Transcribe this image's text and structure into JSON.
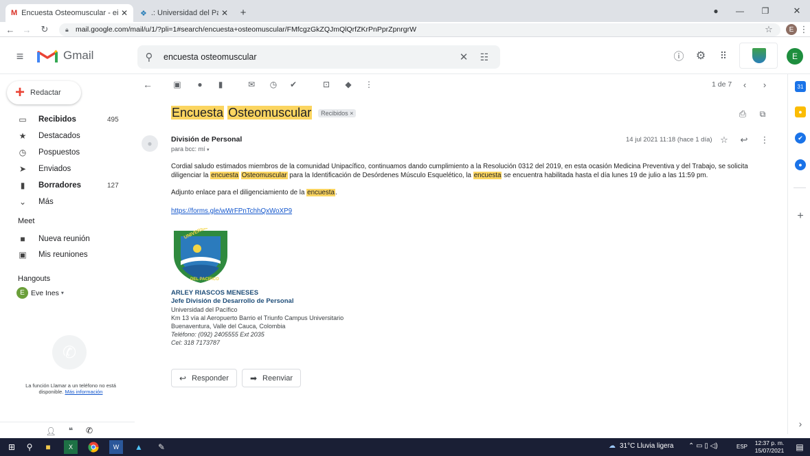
{
  "browser": {
    "tabs": [
      {
        "title": "Encuesta Osteomuscular - einesr",
        "close": "✕"
      },
      {
        "title": ".: Universidad del Pacifico - Buen",
        "close": "✕"
      }
    ],
    "new_tab": "+",
    "url": "mail.google.com/mail/u/1/?pli=1#search/encuesta+osteomuscular/FMfcgzGkZQJmQlQrfZKrPnPprZpnrgrW",
    "profile_initial": "E"
  },
  "gmail": {
    "logo_text": "Gmail",
    "search_value": "encuesta osteomuscular",
    "avatar_initial": "E"
  },
  "sidebar": {
    "compose_label": "Redactar",
    "items": [
      {
        "label": "Recibidos",
        "count": "495",
        "bold": true
      },
      {
        "label": "Destacados",
        "count": ""
      },
      {
        "label": "Pospuestos",
        "count": ""
      },
      {
        "label": "Enviados",
        "count": ""
      },
      {
        "label": "Borradores",
        "count": "127",
        "bold": true
      },
      {
        "label": "Más",
        "count": ""
      }
    ],
    "meet_heading": "Meet",
    "meet_items": [
      "Nueva reunión",
      "Mis reuniones"
    ],
    "hangouts_heading": "Hangouts",
    "hangouts_user": "Eve Ines",
    "hangouts_initial": "E",
    "call_notice": "La función Llamar a un teléfono no está disponible.",
    "call_link": "Más información"
  },
  "toolbar": {
    "pagination": "1 de 7"
  },
  "email": {
    "subject_words": [
      "Encuesta",
      "Osteomuscular"
    ],
    "label_chip": "Recibidos",
    "sender": "División de Personal",
    "to": "para bcc: mí",
    "date": "14 jul 2021 11:18 (hace 1 día)",
    "p1_a": "Cordial saludo estimados miembros de la comunidad Unipacífico, continuamos dando cumplimiento a la Resolución 0312 del  2019, en esta ocasión  Medicina Preventiva y del Trabajo, se solicita diligenciar la ",
    "p1_h1": "encuesta",
    "p1_h2": "Osteomuscular",
    "p1_b": " para la Identificación de Desórdenes  Músculo Esquelético, la ",
    "p1_h3": "encuesta",
    "p1_c": " se encuentra habilitada hasta el día lunes 19 de julio a las 11:59 pm.",
    "p2_a": "Adjunto enlace para el diligenciamiento de la ",
    "p2_h": "encuesta",
    "p2_b": ".",
    "link": "https://forms.gle/wWrFPnTchhQxWoXP9",
    "logo_top_text": "UNIVERSIDAD",
    "logo_bottom_text": "DEL PACIFICO",
    "sig_name": "ARLEY RIASCOS MENESES",
    "sig_title": "Jefe División de Desarrollo de Personal",
    "sig_lines": [
      "Universidad del Pacífico",
      "Km 13 vía al Aeropuerto Barrio el Triunfo Campus Universitario",
      "Buenaventura, Valle del Cauca, Colombia"
    ],
    "sig_phone": "Teléfono: (092) 2405555 Ext 2035",
    "sig_cel": "Cel: 318 7173787",
    "reply_label": "Responder",
    "forward_label": "Reenviar"
  },
  "taskbar": {
    "weather": "31°C  Lluvia ligera",
    "lang": "ESP",
    "time": "12:37 p. m.",
    "date": "15/07/2021"
  },
  "colors": {
    "highlight": "#fbd560",
    "link": "#1155cc",
    "taskbar": "#1a1f35",
    "avatar": "#1e8e3e"
  }
}
